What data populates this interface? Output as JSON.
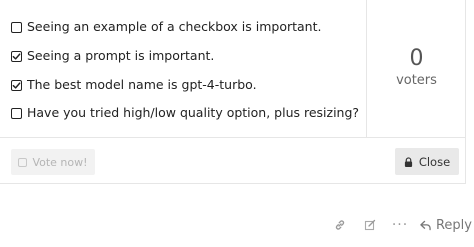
{
  "poll": {
    "options": [
      {
        "label": "Seeing an example of a checkbox is important.",
        "checked": false
      },
      {
        "label": "Seeing a prompt is important.",
        "checked": true
      },
      {
        "label": "The best model name is gpt-4-turbo.",
        "checked": true
      },
      {
        "label": "Have you tried high/low quality option, plus resizing?",
        "checked": false
      }
    ],
    "voter_count": "0",
    "voter_label": "voters",
    "vote_button_label": "Vote now!",
    "close_button_label": "Close"
  },
  "post_actions": {
    "more_label": "···",
    "reply_label": "Reply",
    "icons": [
      "link-icon",
      "edit-icon",
      "more-icon",
      "reply-icon"
    ]
  }
}
